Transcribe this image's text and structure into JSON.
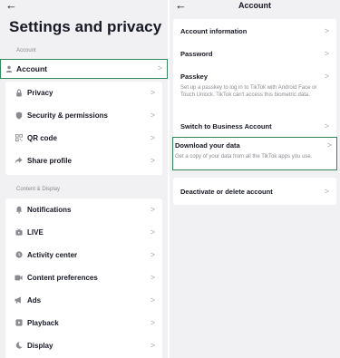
{
  "settings": {
    "back_arrow": "←",
    "title": "Settings and privacy",
    "account_section": "Account",
    "account_item": "Account",
    "account_items": [
      "Privacy",
      "Security & permissions",
      "QR code",
      "Share profile"
    ],
    "content_section": "Content & Display",
    "content_items": [
      "Notifications",
      "LIVE",
      "Activity center",
      "Content preferences",
      "Ads",
      "Playback",
      "Display"
    ]
  },
  "account": {
    "back_arrow": "←",
    "title": "Account",
    "items": {
      "account_information": "Account information",
      "password": "Password",
      "passkey": "Passkey",
      "passkey_desc": "Set up a passkey to log in to TikTok with Android Face or Touch Unlock. TikTok can't access this biometric data.",
      "switch_business": "Switch to Business Account",
      "download_data": "Download your data",
      "download_data_desc": "Get a copy of your data from all the TikTok apps you use.",
      "deactivate": "Deactivate or delete account"
    }
  },
  "chevron": ">",
  "colors": {
    "highlight_border": "#2e8a58",
    "icon_gray": "#8a8b91",
    "background": "#f1f1f3"
  },
  "icons": {
    "account": "person-icon",
    "privacy": "lock-icon",
    "security": "shield-icon",
    "qr_code": "qr-code-icon",
    "share_profile": "share-arrow-icon",
    "notifications": "bell-icon",
    "live": "tv-icon",
    "activity_center": "clock-icon",
    "content_preferences": "video-icon",
    "ads": "megaphone-icon",
    "playback": "play-icon",
    "display": "moon-icon"
  }
}
